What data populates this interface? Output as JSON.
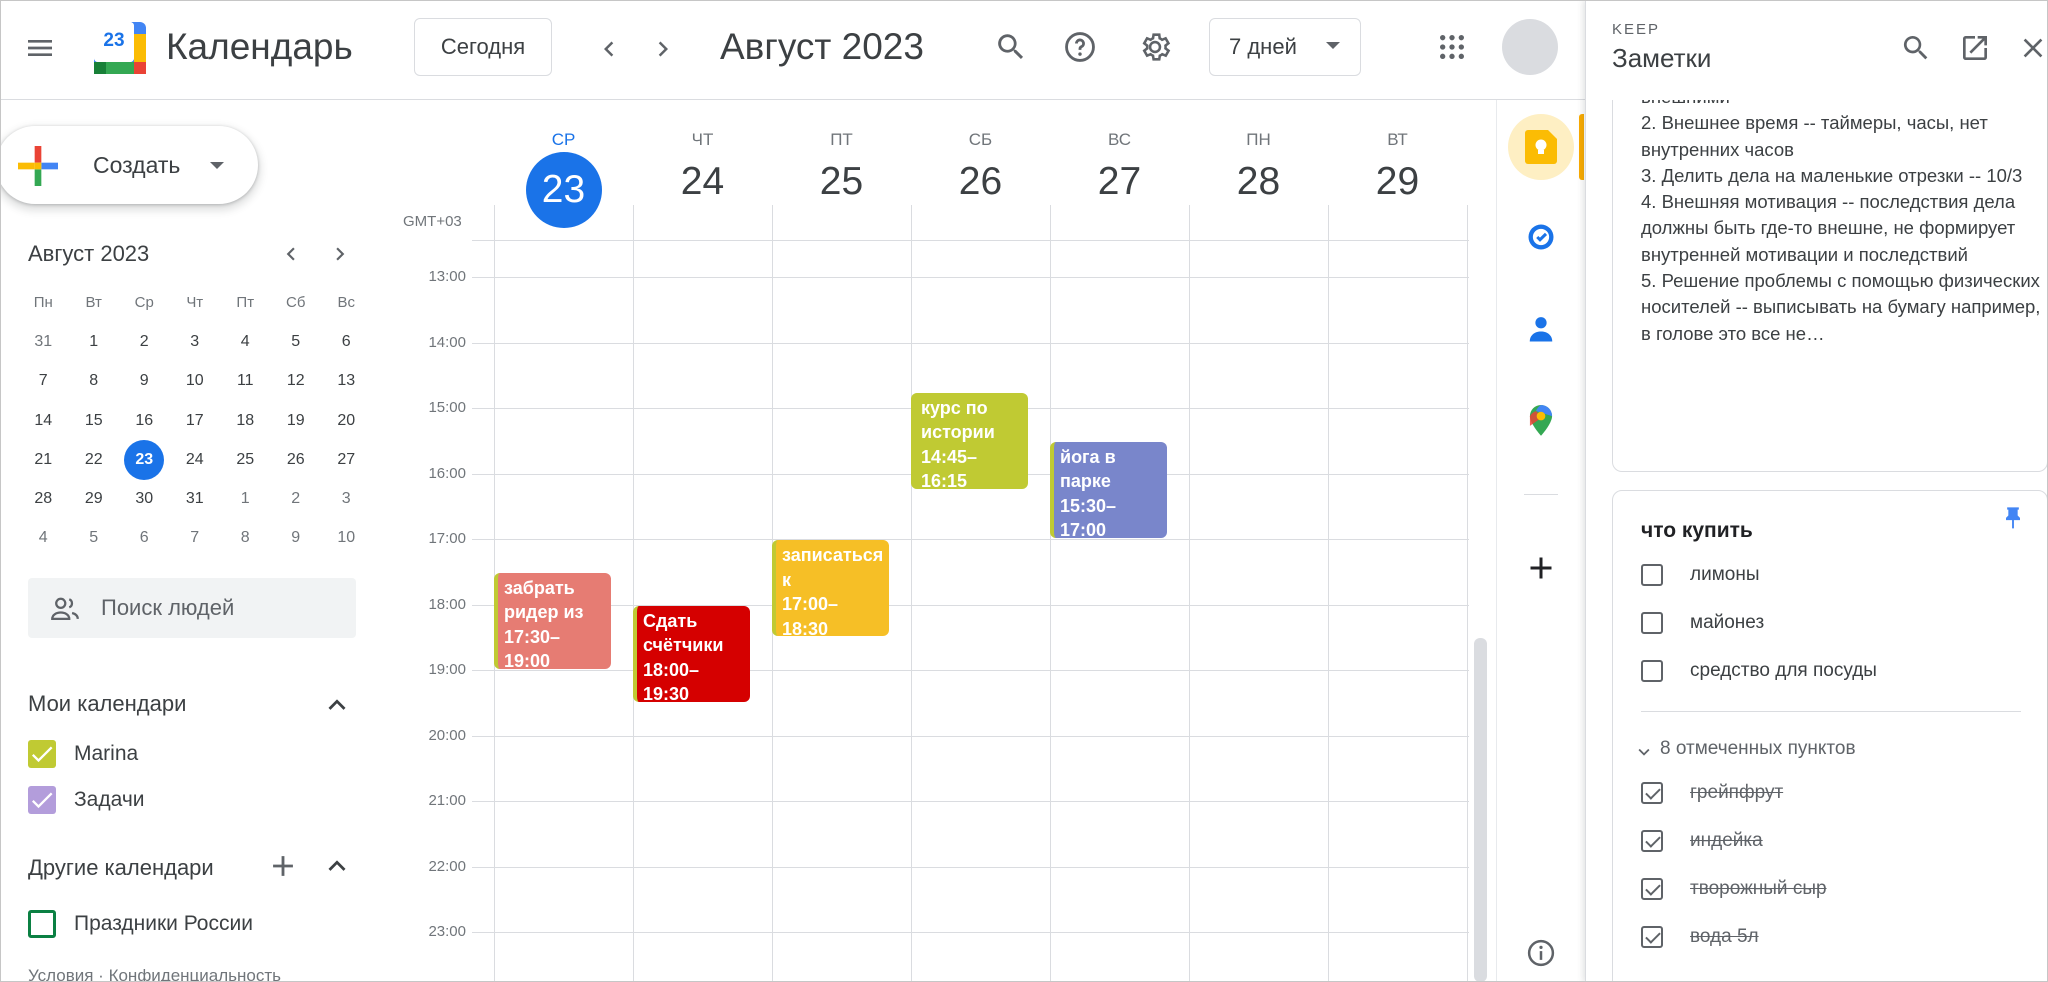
{
  "header": {
    "app_title": "Календарь",
    "logo_number": "23",
    "today_label": "Сегодня",
    "period_title": "Август 2023",
    "view_label": "7 дней"
  },
  "sidebar": {
    "create_label": "Создать",
    "mini_calendar": {
      "title": "Август 2023",
      "dow": [
        "Пн",
        "Вт",
        "Ср",
        "Чт",
        "Пт",
        "Сб",
        "Вс"
      ],
      "weeks": [
        [
          "31",
          "1",
          "2",
          "3",
          "4",
          "5",
          "6"
        ],
        [
          "7",
          "8",
          "9",
          "10",
          "11",
          "12",
          "13"
        ],
        [
          "14",
          "15",
          "16",
          "17",
          "18",
          "19",
          "20"
        ],
        [
          "21",
          "22",
          "23",
          "24",
          "25",
          "26",
          "27"
        ],
        [
          "28",
          "29",
          "30",
          "31",
          "1",
          "2",
          "3"
        ],
        [
          "4",
          "5",
          "6",
          "7",
          "8",
          "9",
          "10"
        ]
      ],
      "today": "23"
    },
    "people_search_placeholder": "Поиск людей",
    "my_calendars_title": "Мои календари",
    "my_calendars": [
      {
        "name": "Marina",
        "color": "#c0ca33",
        "checked": true
      },
      {
        "name": "Задачи",
        "color": "#b39ddb",
        "checked": true
      }
    ],
    "other_calendars_title": "Другие календари",
    "other_calendars": [
      {
        "name": "Праздники России",
        "color": "#0b8043",
        "checked": false
      }
    ],
    "footer_text": "Условия · Конфиденциальность"
  },
  "week": {
    "timezone": "GMT+03",
    "days": [
      {
        "dow": "СР",
        "num": "23",
        "today": true
      },
      {
        "dow": "ЧТ",
        "num": "24"
      },
      {
        "dow": "ПТ",
        "num": "25"
      },
      {
        "dow": "СБ",
        "num": "26"
      },
      {
        "dow": "ВС",
        "num": "27"
      },
      {
        "dow": "ПН",
        "num": "28"
      },
      {
        "dow": "ВТ",
        "num": "29"
      }
    ],
    "hours": [
      "13:00",
      "14:00",
      "15:00",
      "16:00",
      "17:00",
      "18:00",
      "19:00",
      "20:00",
      "21:00",
      "22:00",
      "23:00"
    ],
    "events": [
      {
        "title": "забрать ридер из",
        "time": "17:30–19:00",
        "day_index": 0,
        "start": "17:30",
        "end": "19:00",
        "color": "#e67c73",
        "stripe": "#c0ca33"
      },
      {
        "title": "Сдать счётчики",
        "time": "18:00–19:30",
        "day_index": 1,
        "start": "18:00",
        "end": "19:30",
        "color": "#d50000",
        "stripe": "#c0ca33"
      },
      {
        "title": "записаться к",
        "time": "17:00–18:30",
        "day_index": 2,
        "start": "17:00",
        "end": "18:30",
        "color": "#f6bf26",
        "stripe": "#c0ca33"
      },
      {
        "title": "курс по истории",
        "time": "14:45–16:15",
        "day_index": 3,
        "start": "14:45",
        "end": "16:15",
        "color": "#c0ca33",
        "stripe": "#c0ca33"
      },
      {
        "title": "йога в парке",
        "time": "15:30–17:00",
        "day_index": 4,
        "start": "15:30",
        "end": "17:00",
        "color": "#7986cb",
        "stripe": "#c0ca33"
      }
    ]
  },
  "keep": {
    "brand": "KEEP",
    "title": "Заметки",
    "note1_lines": [
      "внешними",
      "2. Внешнее время -- таймеры, часы, нет внутренних часов",
      "3. Делить дела на маленькие отрезки -- 10/3",
      "4. Внешняя мотивация -- последствия дела должны быть где-то внешне, не формирует внутренней мотивации и последствий",
      "5. Решение проблемы с помощью физических носителей -- выписывать на бумагу например, в голове это все не…"
    ],
    "note2": {
      "title": "что купить",
      "items": [
        "лимоны",
        "майонез",
        "средство для посуды"
      ],
      "checked_count_label": "8 отмеченных пунктов",
      "checked_items": [
        "грейпфрут",
        "индейка",
        "творожный сыр",
        "вода 5л"
      ]
    }
  }
}
